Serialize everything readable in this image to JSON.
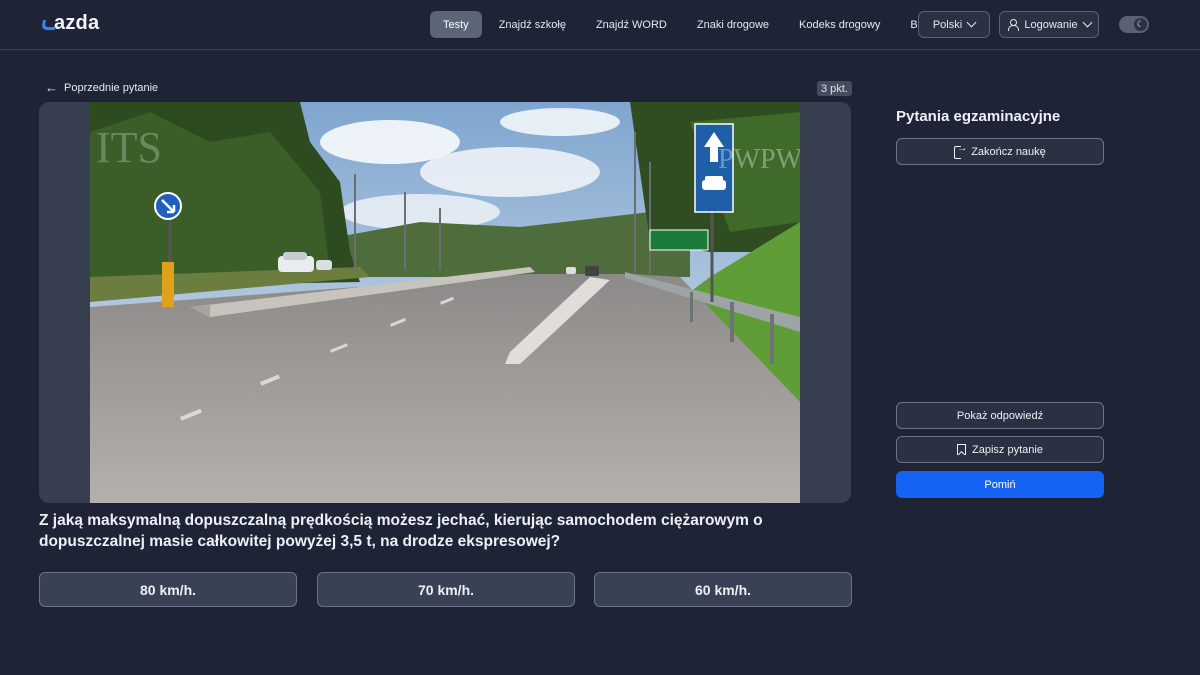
{
  "header": {
    "logo_text": "azda",
    "nav": [
      {
        "label": "Testy",
        "active": true
      },
      {
        "label": "Znajdź szkołę"
      },
      {
        "label": "Znajdź WORD"
      },
      {
        "label": "Znaki drogowe"
      },
      {
        "label": "Kodeks drogowy"
      },
      {
        "label": "Blog"
      }
    ],
    "language": "Polski",
    "login": "Logowanie",
    "theme_toggle": {
      "mode": "dark",
      "icon": "moon-icon"
    }
  },
  "main": {
    "prev_label": "Poprzednie pytanie",
    "points": "3 pkt.",
    "photo_watermarks": [
      "ITS",
      "PWPW"
    ],
    "question": "Z jaką maksymalną dopuszczalną prędkością możesz jechać, kierując samochodem ciężarowym o dopuszczalnej masie całkowitej powyżej 3,5 t, na drodze ekspresowej?",
    "answers": [
      "80 km/h.",
      "70 km/h.",
      "60 km/h."
    ]
  },
  "sidebar": {
    "title": "Pytania egzaminacyjne",
    "finish_label": "Zakończ naukę",
    "show_answer_label": "Pokaż odpowiedź",
    "save_label": "Zapisz pytanie",
    "skip_label": "Pomiń"
  },
  "colors": {
    "background": "#1e2435",
    "accent": "#1463f3",
    "logo_accent": "#3b82f6"
  }
}
